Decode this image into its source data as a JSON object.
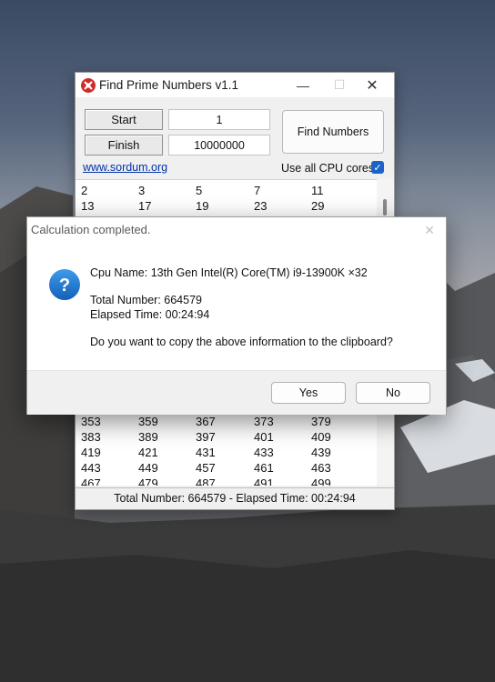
{
  "window": {
    "title": "Find Prime Numbers v1.1",
    "minimize": "—",
    "maximize": "☐",
    "close": "✕"
  },
  "inputs": {
    "start_label": "Start",
    "start_value": "1",
    "finish_label": "Finish",
    "finish_value": "10000000",
    "find_button": "Find Numbers"
  },
  "link": "www.sordum.org",
  "use_all_cores": {
    "label": "Use all CPU cores",
    "checked": true,
    "mark": "✓"
  },
  "primes_top": [
    [
      "2",
      "3",
      "5",
      "7",
      "11"
    ],
    [
      "13",
      "17",
      "19",
      "23",
      "29"
    ]
  ],
  "primes_bottom": [
    [
      "353",
      "359",
      "367",
      "373",
      "379"
    ],
    [
      "383",
      "389",
      "397",
      "401",
      "409"
    ],
    [
      "419",
      "421",
      "431",
      "433",
      "439"
    ],
    [
      "443",
      "449",
      "457",
      "461",
      "463"
    ],
    [
      "467",
      "479",
      "487",
      "491",
      "499"
    ]
  ],
  "status": "Total Number: 664579  -  Elapsed Time: 00:24:94",
  "dialog": {
    "title": "Calculation completed.",
    "close": "✕",
    "icon": "question-icon",
    "icon_glyph": "?",
    "cpu_line": "Cpu Name: 13th Gen Intel(R) Core(TM) i9-13900K ×32",
    "total_line": "Total Number: 664579",
    "elapsed_line": "Elapsed Time: 00:24:94",
    "question": "Do you want to copy the above information to the clipboard?",
    "yes": "Yes",
    "no": "No"
  },
  "colors": {
    "accent": "#1b63c9",
    "link": "#0033aa",
    "question_icon": "#1a73c8"
  }
}
